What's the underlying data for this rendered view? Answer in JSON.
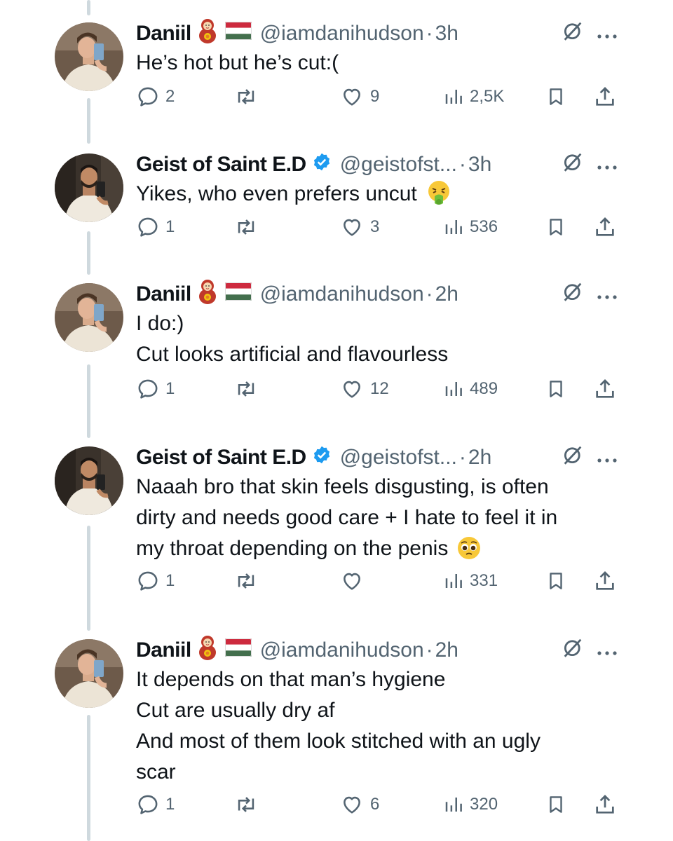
{
  "tweets": [
    {
      "avatar": "daniil",
      "name": "Daniil",
      "emojis": [
        "matryoshka",
        "hungary-flag"
      ],
      "verified": false,
      "handle": "@iamdanihudson",
      "time": "3h",
      "lines": [
        "He’s hot but he’s cut:("
      ],
      "trailing_emoji": "",
      "replies": "2",
      "reposts": "",
      "likes": "9",
      "views": "2,5K"
    },
    {
      "avatar": "geist",
      "name": "Geist of Saint E.D",
      "emojis": [],
      "verified": true,
      "handle": "@geistofst...",
      "time": "3h",
      "lines": [
        "Yikes, who even prefers uncut"
      ],
      "trailing_emoji": "vomiting-face",
      "replies": "1",
      "reposts": "",
      "likes": "3",
      "views": "536"
    },
    {
      "avatar": "daniil",
      "name": "Daniil",
      "emojis": [
        "matryoshka",
        "hungary-flag"
      ],
      "verified": false,
      "handle": "@iamdanihudson",
      "time": "2h",
      "lines": [
        "I do:)",
        "Cut looks artificial and flavourless"
      ],
      "trailing_emoji": "",
      "replies": "1",
      "reposts": "",
      "likes": "12",
      "views": "489"
    },
    {
      "avatar": "geist",
      "name": "Geist of Saint E.D",
      "emojis": [],
      "verified": true,
      "handle": "@geistofst...",
      "time": "2h",
      "lines": [
        "Naaah bro that skin feels disgusting, is often",
        "dirty and needs good care + I hate to feel it in",
        "my throat depending on the penis"
      ],
      "trailing_emoji": "pleading-face",
      "replies": "1",
      "reposts": "",
      "likes": "",
      "views": "331"
    },
    {
      "avatar": "daniil",
      "name": "Daniil",
      "emojis": [
        "matryoshka",
        "hungary-flag"
      ],
      "verified": false,
      "handle": "@iamdanihudson",
      "time": "2h",
      "lines": [
        "It depends on that man’s hygiene",
        "Cut are usually dry af",
        "And most of them look stitched with an ugly",
        "scar"
      ],
      "trailing_emoji": "",
      "replies": "1",
      "reposts": "",
      "likes": "6",
      "views": "320"
    }
  ],
  "colors": {
    "text": "#0f1419",
    "secondary": "#536471",
    "verified": "#1d9bf0",
    "thread": "#cfd9de"
  },
  "icons": [
    "reply-icon",
    "repost-icon",
    "like-icon",
    "views-icon",
    "bookmark-icon",
    "share-icon",
    "grok-icon",
    "more-icon"
  ]
}
